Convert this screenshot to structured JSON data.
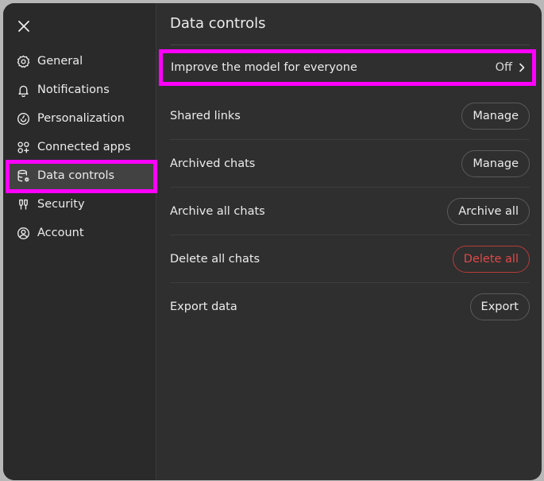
{
  "content": {
    "title": "Data controls",
    "improve": {
      "label": "Improve the model for everyone",
      "value": "Off"
    },
    "rows": [
      {
        "label": "Shared links",
        "action": "Manage"
      },
      {
        "label": "Archived chats",
        "action": "Manage"
      },
      {
        "label": "Archive all chats",
        "action": "Archive all"
      },
      {
        "label": "Delete all chats",
        "action": "Delete all"
      },
      {
        "label": "Export data",
        "action": "Export"
      }
    ]
  },
  "sidebar": {
    "items": [
      {
        "label": "General",
        "icon": "gear-icon"
      },
      {
        "label": "Notifications",
        "icon": "bell-icon"
      },
      {
        "label": "Personalization",
        "icon": "personalization-icon"
      },
      {
        "label": "Connected apps",
        "icon": "apps-grid-icon"
      },
      {
        "label": "Data controls",
        "icon": "database-gear-icon"
      },
      {
        "label": "Security",
        "icon": "security-icon"
      },
      {
        "label": "Account",
        "icon": "account-icon"
      }
    ],
    "active": "Data controls"
  },
  "colors": {
    "highlight": "#ff00ff",
    "danger": "#e04848",
    "panel": "#2f2f2f"
  }
}
